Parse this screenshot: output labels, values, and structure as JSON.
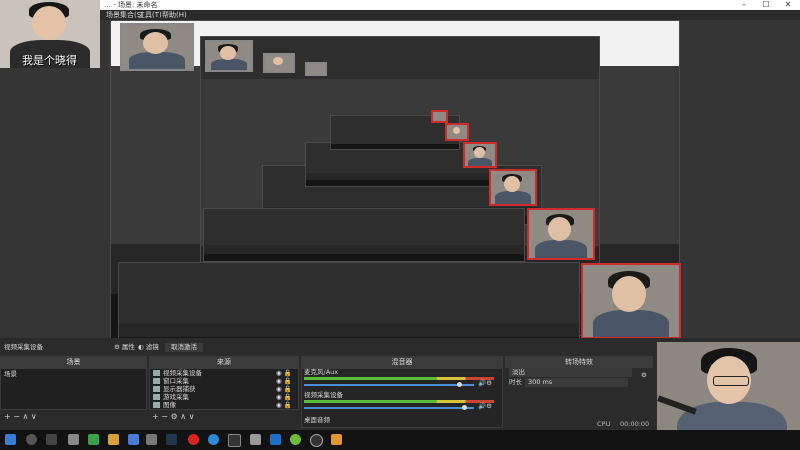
{
  "window": {
    "title": "… - 场景: 未命名"
  },
  "menu": [
    "场景集合(S)",
    "工具(T)",
    "帮助(H)"
  ],
  "webcam_caption": "我是个晓得",
  "docks": {
    "scenes": {
      "title": "场景",
      "items": [
        "场景"
      ]
    },
    "sources": {
      "title": "来源",
      "items": [
        "视频采集设备",
        "窗口采集",
        "显示器捕获",
        "游戏采集",
        "图像"
      ]
    },
    "mixer": {
      "title": "混音器",
      "ch1": "麦克风/Aux",
      "ch2": "视频采集设备",
      "ch3": "桌面音频"
    },
    "transitions": {
      "title": "转场特效",
      "type": "淡出",
      "duration_label": "时长",
      "duration": "300 ms"
    }
  },
  "source_bar": {
    "label": "视频采集设备",
    "properties": "属性",
    "filters": "滤镜",
    "deactivate": "取消激活"
  },
  "status": {
    "cpu": "CPU",
    "time": "00:00:00"
  },
  "colors": {
    "accent": "#d12a2a",
    "meter_green": "#5cbf3a",
    "slider_blue": "#4a8fd8"
  }
}
